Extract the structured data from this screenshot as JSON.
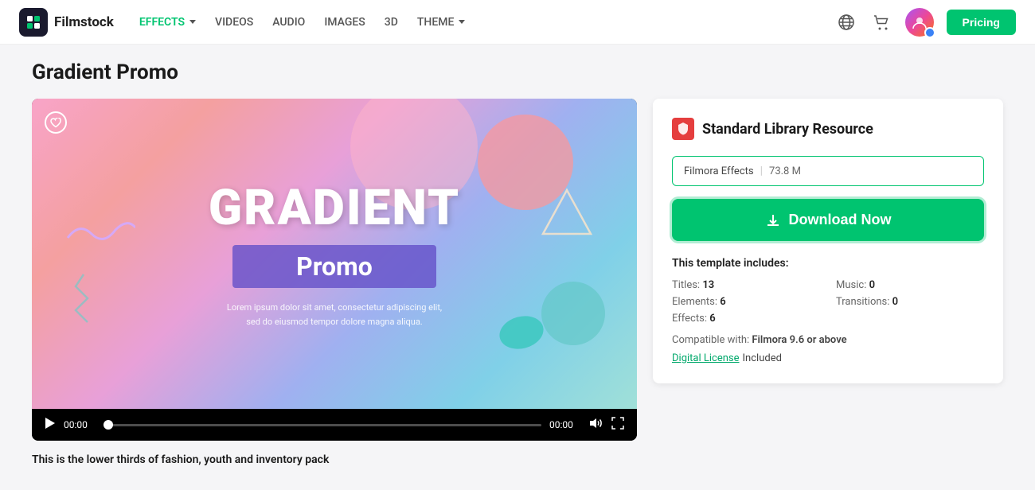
{
  "nav": {
    "logo_text": "Filmstock",
    "links": [
      {
        "id": "effects",
        "label": "EFFECTS",
        "active": true,
        "has_arrow": true
      },
      {
        "id": "videos",
        "label": "VIDEOS",
        "active": false,
        "has_arrow": false
      },
      {
        "id": "audio",
        "label": "AUDIO",
        "active": false,
        "has_arrow": false
      },
      {
        "id": "images",
        "label": "IMAGES",
        "active": false,
        "has_arrow": false
      },
      {
        "id": "3d",
        "label": "3D",
        "active": false,
        "has_arrow": false
      },
      {
        "id": "theme",
        "label": "THEME",
        "active": false,
        "has_arrow": true
      }
    ],
    "pricing_label": "Pricing"
  },
  "page": {
    "title": "Gradient Promo"
  },
  "video": {
    "gradient_title": "GRADIENT",
    "promo_label": "Promo",
    "lorem_line1": "Lorem ipsum dolor sit amet, consectetur adipiscing elit,",
    "lorem_line2": "sed do eiusmod tempor dolore magna aliqua.",
    "time_start": "00:00",
    "time_end": "00:00"
  },
  "sidebar": {
    "standard_library_label": "Standard Library Resource",
    "resource_name": "Filmora Effects",
    "resource_size": "73.8 M",
    "download_label": "Download Now",
    "template_includes_label": "This template includes:",
    "stats": [
      {
        "label": "Titles:",
        "value": "13"
      },
      {
        "label": "Music:",
        "value": "0"
      },
      {
        "label": "Elements:",
        "value": "6"
      },
      {
        "label": "Transitions:",
        "value": "0"
      },
      {
        "label": "Effects:",
        "value": "6"
      }
    ],
    "compatible_label": "Compatible with:",
    "compatible_value": "Filmora 9.6 or above",
    "digital_license_label": "Digital License",
    "included_label": "Included"
  },
  "bottom": {
    "description": "This is the lower thirds of fashion, youth and inventory pack"
  }
}
